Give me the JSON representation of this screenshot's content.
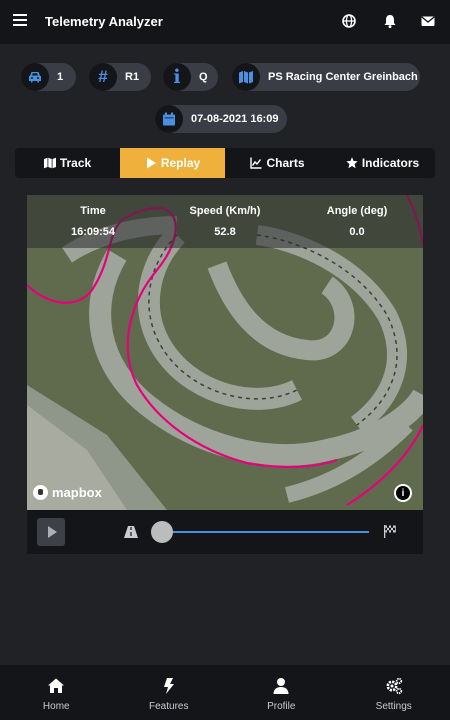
{
  "header": {
    "title": "Telemetry Analyzer"
  },
  "info": {
    "kart": "1",
    "round": "R1",
    "session": "Q",
    "track": "PS Racing Center Greinbach",
    "datetime": "07-08-2021 16:09"
  },
  "tabs": [
    {
      "label": "Track"
    },
    {
      "label": "Replay"
    },
    {
      "label": "Charts"
    },
    {
      "label": "Indicators"
    }
  ],
  "active_tab": "Replay",
  "telemetry": {
    "time_label": "Time",
    "time_value": "16:09:54",
    "speed_label": "Speed (Km/h)",
    "speed_value": "52.8",
    "angle_label": "Angle (deg)",
    "angle_value": "0.0"
  },
  "map": {
    "attribution": "mapbox"
  },
  "replay": {
    "progress": 0.0
  },
  "bottom_nav": [
    {
      "label": "Home"
    },
    {
      "label": "Features"
    },
    {
      "label": "Profile"
    },
    {
      "label": "Settings"
    }
  ],
  "colors": {
    "accent": "#f0b03c",
    "icon_blue": "#4a90e2",
    "racing_line": "#e6007e",
    "background": "#212226",
    "bar": "#141518"
  }
}
